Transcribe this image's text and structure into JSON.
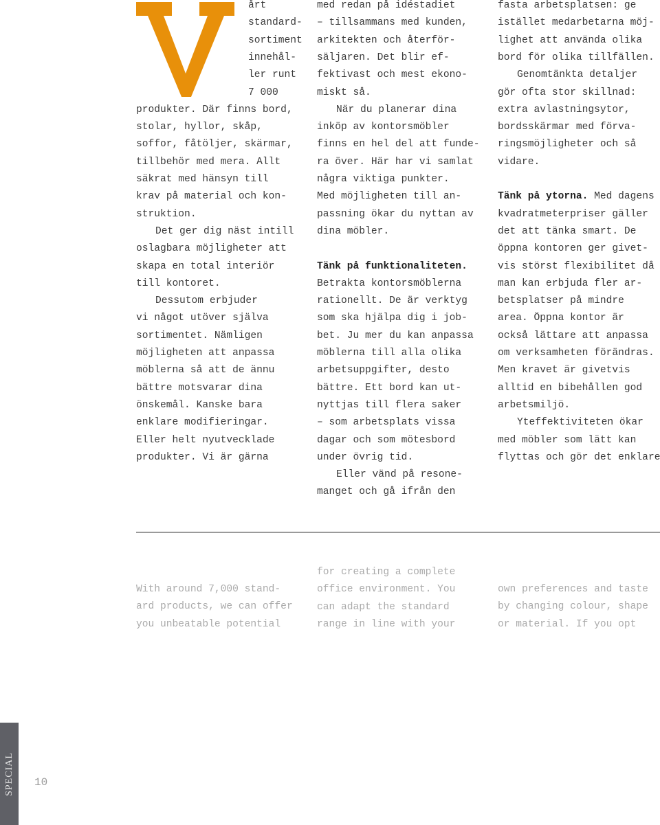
{
  "dropcap": {
    "letter": "V",
    "color": "#E8900A"
  },
  "swedish": {
    "col1": [
      {
        "t": "årt",
        "x": "after-cap"
      },
      {
        "t": "standard-",
        "x": "after-cap"
      },
      {
        "t": "sortiment",
        "x": "after-cap"
      },
      {
        "t": "innehål-",
        "x": "after-cap"
      },
      {
        "t": "ler runt",
        "x": "after-cap"
      },
      {
        "t": "7 000",
        "x": "after-cap"
      },
      {
        "t": "produkter. Där finns bord,"
      },
      {
        "t": "stolar, hyllor, skåp,"
      },
      {
        "t": "soffor, fåtöljer, skärmar,"
      },
      {
        "t": "tillbehör med mera. Allt"
      },
      {
        "t": "säkrat med hänsyn till"
      },
      {
        "t": "krav på material och kon-"
      },
      {
        "t": "struktion."
      },
      {
        "t": "Det ger dig näst intill",
        "i": true
      },
      {
        "t": "oslagbara möjligheter att"
      },
      {
        "t": "skapa en total interiör"
      },
      {
        "t": "till kontoret."
      },
      {
        "t": "Dessutom erbjuder",
        "i": true
      },
      {
        "t": "vi något utöver själva"
      },
      {
        "t": "sortimentet. Nämligen"
      },
      {
        "t": "möjligheten att anpassa"
      },
      {
        "t": "möblerna så att de ännu"
      },
      {
        "t": "bättre motsvarar dina"
      },
      {
        "t": "önskemål. Kanske bara"
      },
      {
        "t": "enklare modifieringar."
      },
      {
        "t": "Eller helt nyutvecklade"
      },
      {
        "t": "produkter. Vi är gärna"
      }
    ],
    "col2": [
      {
        "t": "med redan på idéstadiet"
      },
      {
        "t": "– tillsammans med kunden,"
      },
      {
        "t": "arkitekten och återför-"
      },
      {
        "t": "säljaren. Det blir ef-"
      },
      {
        "t": "fektivast och mest ekono-"
      },
      {
        "t": "miskt så."
      },
      {
        "t": "När du planerar dina",
        "i": true
      },
      {
        "t": "inköp av kontorsmöbler"
      },
      {
        "t": "finns en hel del att funde-"
      },
      {
        "t": "ra över. Här har vi samlat"
      },
      {
        "t": "några viktiga punkter."
      },
      {
        "t": "Med möjligheten till an-"
      },
      {
        "t": "passning ökar du nyttan av"
      },
      {
        "t": "dina möbler."
      },
      {
        "t": ""
      },
      {
        "b": "Tänk på funktionaliteten.",
        "t": ""
      },
      {
        "t": "Betrakta kontorsmöblerna"
      },
      {
        "t": "rationellt. De är verktyg"
      },
      {
        "t": "som ska hjälpa dig i job-"
      },
      {
        "t": "bet. Ju mer du kan anpassa"
      },
      {
        "t": "möblerna till alla olika"
      },
      {
        "t": "arbetsuppgifter, desto"
      },
      {
        "t": "bättre. Ett bord kan ut-"
      },
      {
        "t": "nyttjas till flera saker"
      },
      {
        "t": "– som arbetsplats vissa"
      },
      {
        "t": "dagar och som mötesbord"
      },
      {
        "t": "under övrig tid."
      },
      {
        "t": "Eller vänd på resone-",
        "i": true
      },
      {
        "t": "manget och gå ifrån den"
      }
    ],
    "col3": [
      {
        "t": "fasta arbetsplatsen: ge"
      },
      {
        "t": "istället medarbetarna möj-"
      },
      {
        "t": "lighet att använda olika"
      },
      {
        "t": "bord för olika tillfällen."
      },
      {
        "t": "Genomtänkta detaljer",
        "i": true
      },
      {
        "t": "gör ofta stor skillnad:"
      },
      {
        "t": "extra avlastningsytor,"
      },
      {
        "t": "bordsskärmar med förva-"
      },
      {
        "t": "ringsmöjligheter och så"
      },
      {
        "t": "vidare."
      },
      {
        "t": ""
      },
      {
        "b": "Tänk på ytorna.",
        "t": " Med dagens"
      },
      {
        "t": "kvadratmeterpriser gäller"
      },
      {
        "t": "det att tänka smart. De"
      },
      {
        "t": "öppna kontoren ger givet-"
      },
      {
        "t": "vis störst flexibilitet då"
      },
      {
        "t": "man kan erbjuda fler ar-"
      },
      {
        "t": "betsplatser på mindre"
      },
      {
        "t": "area. Öppna kontor är"
      },
      {
        "t": "också lättare att anpassa"
      },
      {
        "t": "om verksamheten förändras."
      },
      {
        "t": "Men kravet är givetvis"
      },
      {
        "t": "alltid en bibehållen god"
      },
      {
        "t": "arbetsmiljö."
      },
      {
        "t": "Yteffektiviteten ökar",
        "i": true
      },
      {
        "t": "med möbler som lätt kan"
      },
      {
        "t": "flyttas och gör det enklare"
      }
    ]
  },
  "english": {
    "col1": [
      "With around 7,000 stand-",
      "ard products, we can offer",
      "you unbeatable potential"
    ],
    "col2": [
      "for creating a complete",
      "office environment. You",
      "can adapt the standard",
      "range in line with your"
    ],
    "col3": [
      "own preferences and taste",
      "by changing colour, shape",
      "or material. If you opt"
    ]
  },
  "footer": {
    "section_label": "SPECIAL",
    "page_number": "10",
    "tab_color": "#5F6066"
  }
}
